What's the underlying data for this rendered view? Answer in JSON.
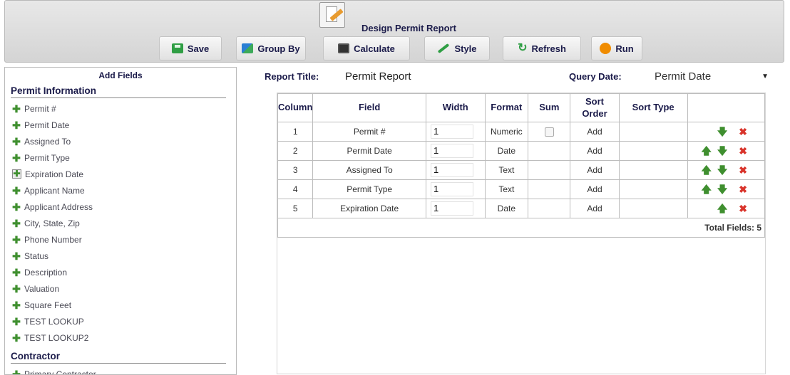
{
  "header": {
    "title": "Design Permit Report",
    "toolbar": [
      {
        "label": "Save",
        "icon": "save-icon"
      },
      {
        "label": "Group By",
        "icon": "group-by-icon"
      },
      {
        "label": "Calculate",
        "icon": "calculator-icon"
      },
      {
        "label": "Style",
        "icon": "brush-icon"
      },
      {
        "label": "Refresh",
        "icon": "refresh-icon"
      },
      {
        "label": "Run",
        "icon": "run-icon"
      }
    ]
  },
  "left_panel": {
    "title": "Add Fields",
    "sections": [
      {
        "title": "Permit Information",
        "items": [
          "Permit #",
          "Permit Date",
          "Assigned To",
          "Permit Type",
          "Expiration Date",
          "Applicant Name",
          "Applicant Address",
          "City, State, Zip",
          "Phone Number",
          "Status",
          "Description",
          "Valuation",
          "Square Feet",
          "TEST LOOKUP",
          "TEST LOOKUP2"
        ]
      },
      {
        "title": "Contractor",
        "items": [
          "Primary Contractor"
        ]
      }
    ]
  },
  "report": {
    "title_label": "Report Title:",
    "title_value": "Permit Report",
    "query_date_label": "Query Date:",
    "query_date_value": "Permit Date"
  },
  "table": {
    "columns": [
      "Column",
      "Field",
      "Width",
      "Format",
      "Sum",
      "Sort Order",
      "Sort Type"
    ],
    "rows": [
      {
        "num": "1",
        "field": "Permit #",
        "width": "1",
        "format": "Numeric",
        "sum": "checkbox",
        "sort_order": "Add",
        "sort_type": ""
      },
      {
        "num": "2",
        "field": "Permit Date",
        "width": "1",
        "format": "Date",
        "sum": "",
        "sort_order": "Add",
        "sort_type": ""
      },
      {
        "num": "3",
        "field": "Assigned To",
        "width": "1",
        "format": "Text",
        "sum": "",
        "sort_order": "Add",
        "sort_type": ""
      },
      {
        "num": "4",
        "field": "Permit Type",
        "width": "1",
        "format": "Text",
        "sum": "",
        "sort_order": "Add",
        "sort_type": ""
      },
      {
        "num": "5",
        "field": "Expiration Date",
        "width": "1",
        "format": "Date",
        "sum": "",
        "sort_order": "Add",
        "sort_type": ""
      }
    ],
    "total": "Total Fields: 5"
  },
  "colors": {
    "label_navy": "#1b1b4a",
    "link_blue": "#2b3aa8",
    "move_green": "#3f8f2f",
    "delete_red": "#d9342b"
  }
}
